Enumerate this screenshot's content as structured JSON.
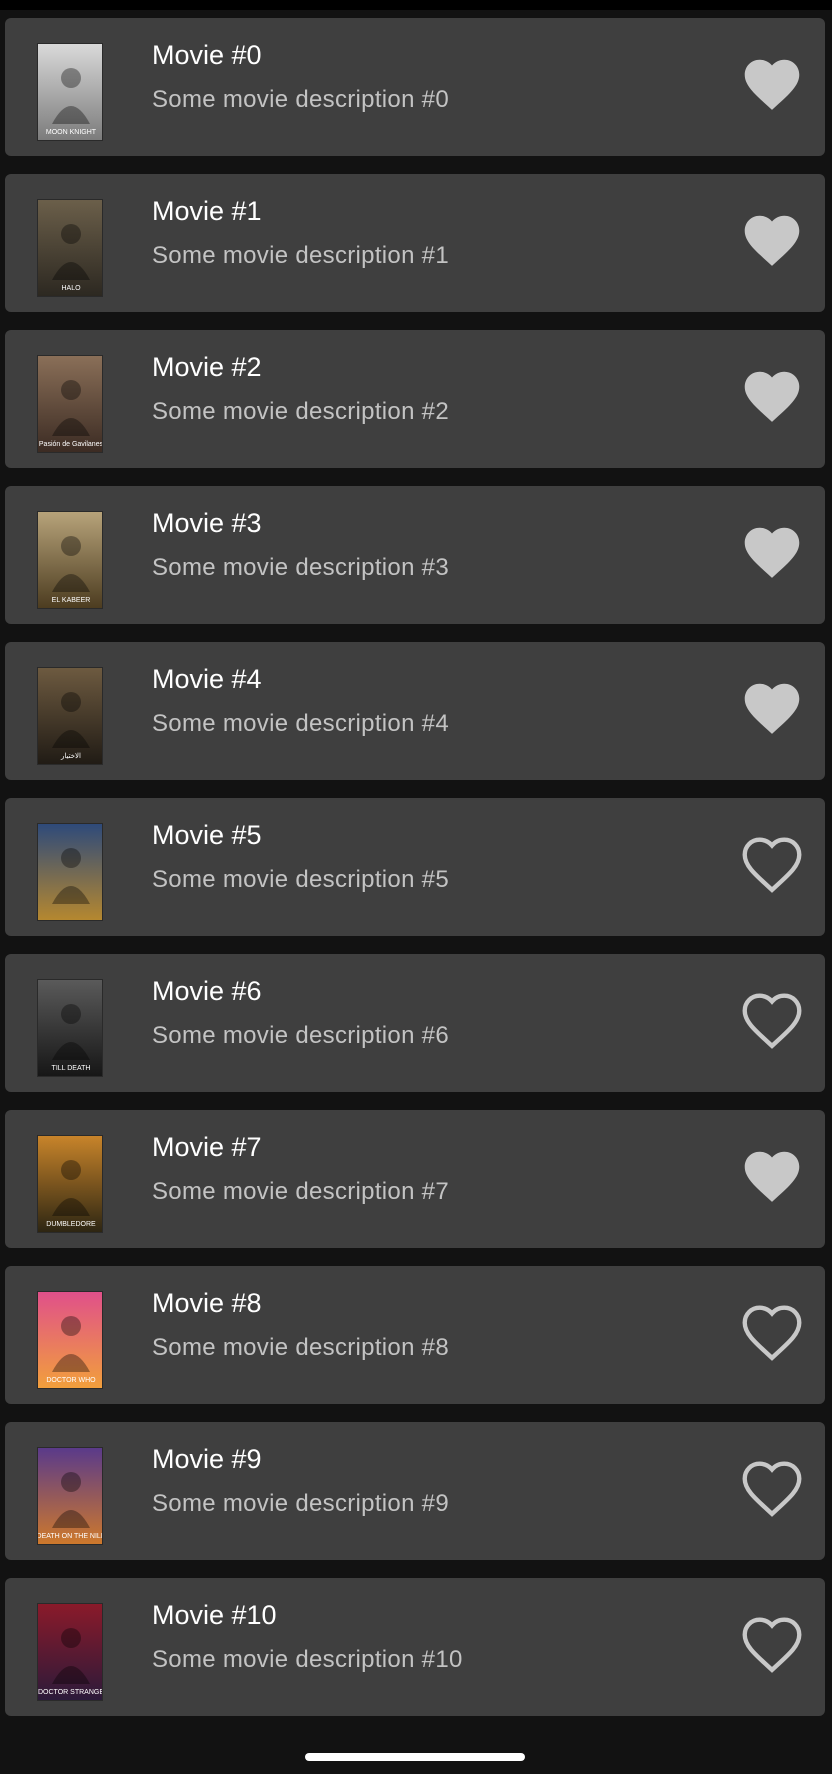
{
  "colors": {
    "background": "#121212",
    "card": "#3f3f3f",
    "title_text": "#ffffff",
    "description_text": "#c3c3c3",
    "heart": "#c8c8c8"
  },
  "movies": [
    {
      "title": "Movie #0",
      "description": "Some movie description #0",
      "favorite": true,
      "poster_icon": "movie-poster",
      "poster_caption": "MOON KNIGHT",
      "poster_colors": [
        "#d9d9d9",
        "#7a7a7a"
      ]
    },
    {
      "title": "Movie #1",
      "description": "Some movie description #1",
      "favorite": true,
      "poster_icon": "movie-poster",
      "poster_caption": "HALO",
      "poster_colors": [
        "#6b5f4a",
        "#2b2720"
      ]
    },
    {
      "title": "Movie #2",
      "description": "Some movie description #2",
      "favorite": true,
      "poster_icon": "movie-poster",
      "poster_caption": "Pasión de Gavilanes",
      "poster_colors": [
        "#8a6f58",
        "#3a2a22"
      ]
    },
    {
      "title": "Movie #3",
      "description": "Some movie description #3",
      "favorite": true,
      "poster_icon": "movie-poster",
      "poster_caption": "EL KABEER",
      "poster_colors": [
        "#b7a37a",
        "#4a3a1e"
      ]
    },
    {
      "title": "Movie #4",
      "description": "Some movie description #4",
      "favorite": true,
      "poster_icon": "movie-poster",
      "poster_caption": "الاختيار",
      "poster_colors": [
        "#6d5a40",
        "#1f1a14"
      ]
    },
    {
      "title": "Movie #5",
      "description": "Some movie description #5",
      "favorite": false,
      "poster_icon": "movie-poster",
      "poster_caption": "",
      "poster_colors": [
        "#2e4a7a",
        "#b8892e"
      ]
    },
    {
      "title": "Movie #6",
      "description": "Some movie description #6",
      "favorite": false,
      "poster_icon": "movie-poster",
      "poster_caption": "TILL DEATH",
      "poster_colors": [
        "#5a5a5a",
        "#151515"
      ]
    },
    {
      "title": "Movie #7",
      "description": "Some movie description #7",
      "favorite": true,
      "poster_icon": "movie-poster",
      "poster_caption": "DUMBLEDORE",
      "poster_colors": [
        "#c8842a",
        "#2a2412"
      ]
    },
    {
      "title": "Movie #8",
      "description": "Some movie description #8",
      "favorite": false,
      "poster_icon": "movie-poster",
      "poster_caption": "DOCTOR WHO",
      "poster_colors": [
        "#e0508a",
        "#f2a13a"
      ]
    },
    {
      "title": "Movie #9",
      "description": "Some movie description #9",
      "favorite": false,
      "poster_icon": "movie-poster",
      "poster_caption": "DEATH ON THE NILE",
      "poster_colors": [
        "#5a3a8a",
        "#d07a2a"
      ]
    },
    {
      "title": "Movie #10",
      "description": "Some movie description #10",
      "favorite": false,
      "poster_icon": "movie-poster",
      "poster_caption": "DOCTOR STRANGE",
      "poster_colors": [
        "#8a1a2a",
        "#2a1a3a"
      ]
    }
  ]
}
